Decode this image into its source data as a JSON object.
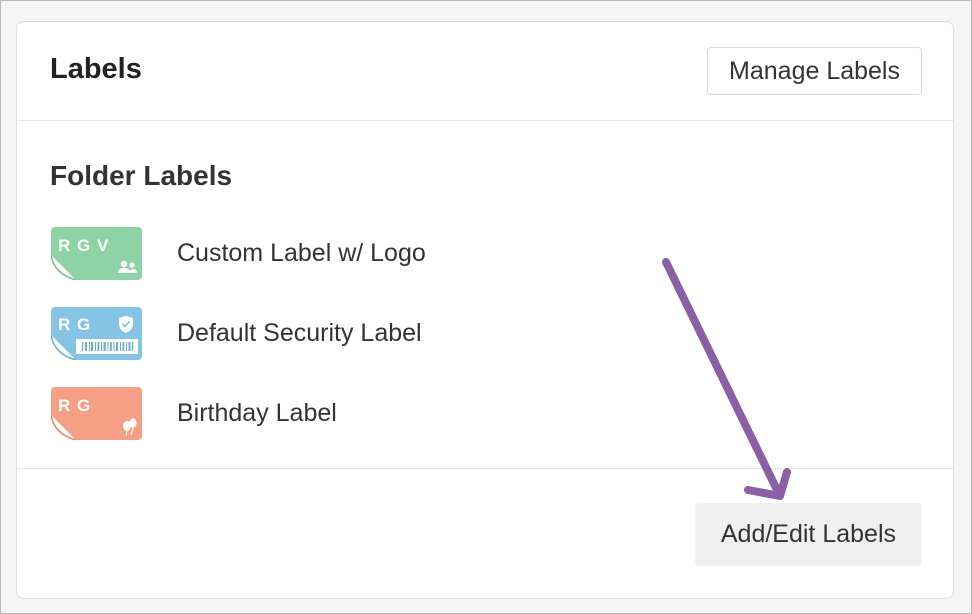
{
  "card": {
    "title": "Labels",
    "manage_button": "Manage Labels",
    "section_title": "Folder Labels",
    "add_button": "Add/Edit Labels"
  },
  "labels": [
    {
      "name": "Custom Label w/ Logo",
      "badge": "R G V",
      "color": "#8ed3a6",
      "icon": "people-icon"
    },
    {
      "name": "Default Security Label",
      "badge": "R G",
      "color": "#86c4e6",
      "icon": "shield-check-icon"
    },
    {
      "name": "Birthday Label",
      "badge": "R G",
      "color": "#f5a084",
      "icon": "balloons-icon"
    }
  ],
  "annotation": {
    "arrow_color": "#8a5fa6"
  }
}
